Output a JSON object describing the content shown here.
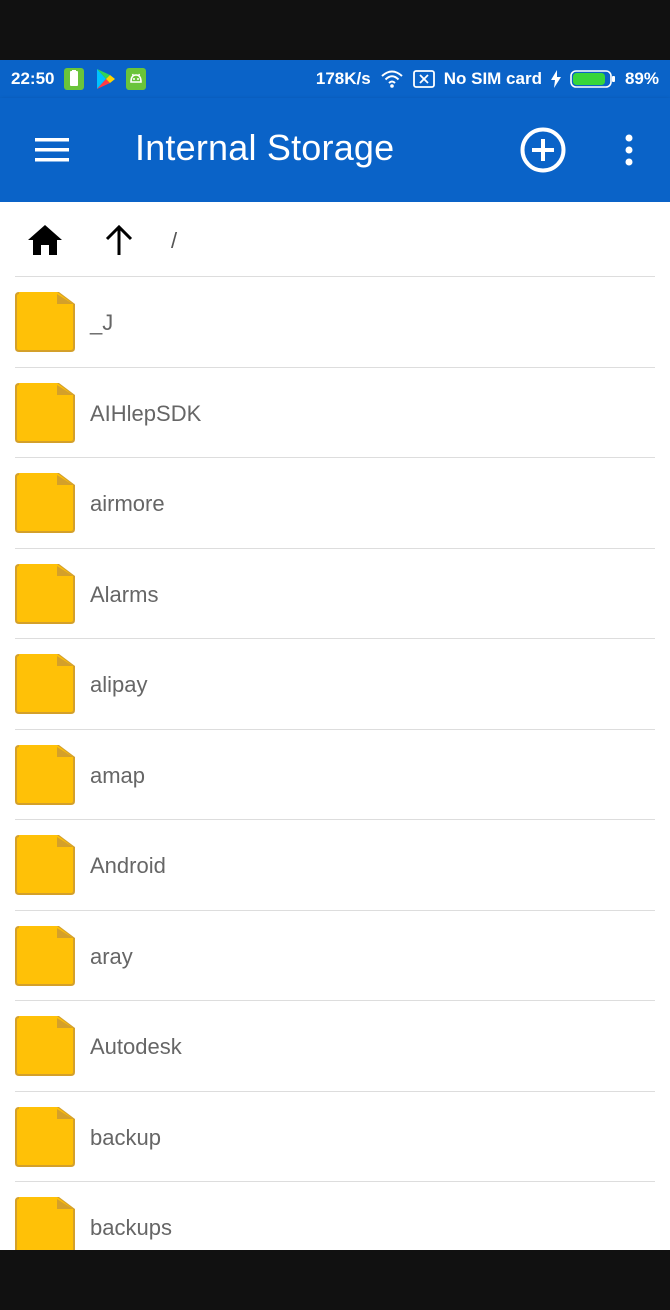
{
  "status_bar": {
    "time": "22:50",
    "network_speed": "178K/s",
    "sim_status": "No SIM card",
    "battery_percent": "89%",
    "battery_level": 0.89,
    "icons": [
      "battery-saver-icon",
      "play-store-icon",
      "android-notification-icon",
      "wifi-icon",
      "sim-x-icon",
      "charging-bolt-icon",
      "battery-icon"
    ]
  },
  "app_bar": {
    "title": "Internal Storage",
    "icons": [
      "menu-icon",
      "add-circle-icon",
      "more-vert-icon"
    ]
  },
  "path_bar": {
    "path": "/",
    "icons": [
      "home-icon",
      "arrow-up-icon"
    ]
  },
  "folders": [
    {
      "name": "_J"
    },
    {
      "name": "AIHlepSDK"
    },
    {
      "name": "airmore"
    },
    {
      "name": "Alarms"
    },
    {
      "name": "alipay"
    },
    {
      "name": "amap"
    },
    {
      "name": "Android"
    },
    {
      "name": "aray"
    },
    {
      "name": "Autodesk"
    },
    {
      "name": "backup"
    },
    {
      "name": "backups"
    }
  ],
  "colors": {
    "app_bar": "#0a63c8",
    "folder": "#ffc107",
    "folder_tab": "#d4a02a",
    "item_text": "#666666"
  }
}
